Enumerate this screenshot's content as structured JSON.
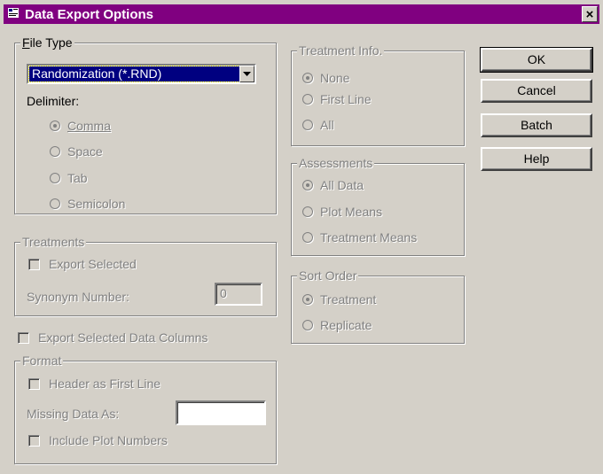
{
  "window": {
    "title": "Data Export Options",
    "close_label": "×"
  },
  "file_type": {
    "legend": "File Type",
    "selected": "Randomization (*.RND)",
    "delimiter_label": "Delimiter:",
    "delimiters": [
      {
        "label": "Comma",
        "checked": true
      },
      {
        "label": "Space",
        "checked": false
      },
      {
        "label": "Tab",
        "checked": false
      },
      {
        "label": "Semicolon",
        "checked": false
      }
    ]
  },
  "treatments": {
    "legend": "Treatments",
    "export_selected": "Export Selected",
    "synonym_label": "Synonym Number:",
    "synonym_value": "0"
  },
  "export_selected_columns": "Export Selected Data Columns",
  "format": {
    "legend": "Format",
    "header_first_line": "Header as First Line",
    "missing_label": "Missing Data As:",
    "missing_value": "",
    "include_plot_numbers": "Include Plot Numbers"
  },
  "treatment_info": {
    "legend": "Treatment Info.",
    "options": [
      {
        "label": "None",
        "checked": true
      },
      {
        "label": "First Line",
        "checked": false
      },
      {
        "label": "All",
        "checked": false
      }
    ]
  },
  "assessments": {
    "legend": "Assessments",
    "options": [
      {
        "label": "All Data",
        "checked": true
      },
      {
        "label": "Plot Means",
        "checked": false
      },
      {
        "label": "Treatment Means",
        "checked": false
      }
    ]
  },
  "sort_order": {
    "legend": "Sort Order",
    "options": [
      {
        "label": "Treatment",
        "checked": true
      },
      {
        "label": "Replicate",
        "checked": false
      }
    ]
  },
  "buttons": {
    "ok": "OK",
    "cancel": "Cancel",
    "batch": "Batch",
    "help": "Help"
  }
}
